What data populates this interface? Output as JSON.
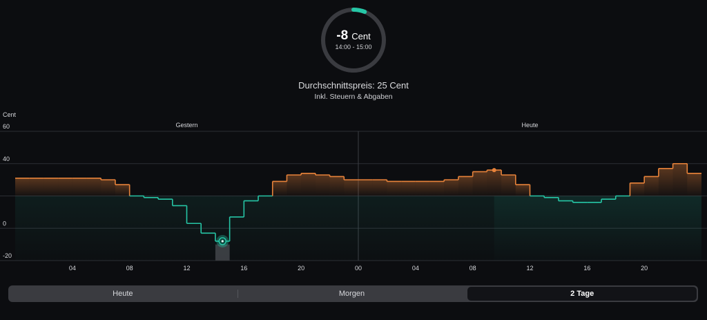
{
  "gauge": {
    "value": "-8",
    "unit": "Cent",
    "time_range": "14:00 - 15:00",
    "fill_fraction": 0.06,
    "accent": "#26c6a6"
  },
  "summary": {
    "average": "Durchschnittspreis: 25 Cent",
    "note": "Inkl. Steuern & Abgaben"
  },
  "tabs": [
    {
      "label": "Heute"
    },
    {
      "label": "Morgen"
    },
    {
      "label": "2 Tage",
      "active": true
    }
  ],
  "chart_data": {
    "type": "line",
    "ylabel": "Cent",
    "ylim": [
      -20,
      60
    ],
    "yticks": [
      60,
      40,
      20,
      0,
      -20
    ],
    "ytick_labels": [
      "60",
      "40",
      "",
      "0",
      "-20"
    ],
    "xlim": [
      0,
      48
    ],
    "xticks": [
      4,
      8,
      12,
      16,
      20,
      24,
      28,
      32,
      36,
      40,
      44
    ],
    "xtick_labels": [
      "04",
      "08",
      "12",
      "16",
      "20",
      "00",
      "04",
      "08",
      "12",
      "16",
      "20"
    ],
    "day_labels": [
      {
        "label": "Gestern",
        "x": 12
      },
      {
        "label": "Heute",
        "x": 36
      }
    ],
    "threshold": 20,
    "current_hour": 33.5,
    "selected_hour": 14,
    "colors": {
      "above": "#e8833a",
      "below": "#26c6a6",
      "grid": "#2c2e34",
      "selected": "#3a3b40"
    },
    "series": [
      {
        "values": [
          31,
          31,
          31,
          31,
          31,
          31,
          30,
          27,
          20,
          19,
          18,
          14,
          3,
          -3,
          -8,
          7,
          17,
          20,
          29,
          33,
          34,
          33,
          32,
          30,
          30,
          30,
          29,
          29,
          29,
          29,
          30,
          32,
          35,
          36,
          33,
          27,
          20,
          19,
          17,
          16,
          16,
          18,
          20,
          28,
          32,
          37,
          40,
          34,
          32,
          31
        ]
      }
    ]
  }
}
